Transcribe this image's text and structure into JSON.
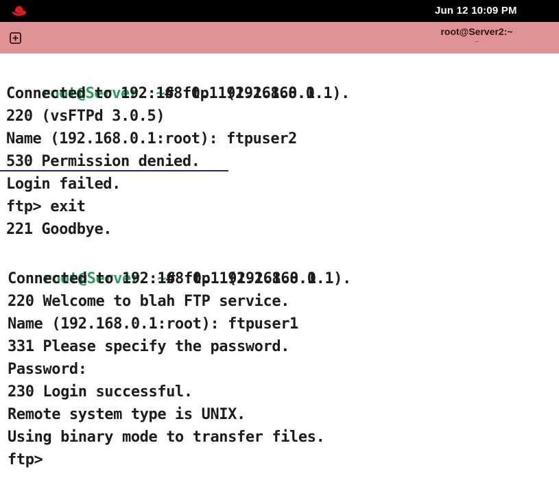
{
  "system_bar": {
    "clock": "Jun 12  10:09 PM"
  },
  "window": {
    "title": "root@Server2:~",
    "subtitle": "~"
  },
  "terminal": {
    "prompt1": {
      "user": "root",
      "at": "@",
      "host": "Server2",
      "colon": ":",
      "path": "~",
      "symbol": "# ",
      "command": "ftp 192.168.0.1"
    },
    "block1": [
      "Connected to 192.168.0.1 (192.168.0.1).",
      "220 (vsFTPd 3.0.5)",
      "Name (192.168.0.1:root): ftpuser2",
      "530 Permission denied.",
      "Login failed.",
      "ftp> exit",
      "221 Goodbye."
    ],
    "prompt2": {
      "user": "root",
      "at": "@",
      "host": "Server2",
      "colon": ":",
      "path": "~",
      "symbol": "# ",
      "command": "ftp 192.168.0.1"
    },
    "block2": [
      "Connected to 192.168.0.1 (192.168.0.1).",
      "220 Welcome to blah FTP service.",
      "Name (192.168.0.1:root): ftpuser1",
      "331 Please specify the password.",
      "Password:",
      "230 Login successful.",
      "Remote system type is UNIX.",
      "Using binary mode to transfer files.",
      "ftp>"
    ]
  }
}
